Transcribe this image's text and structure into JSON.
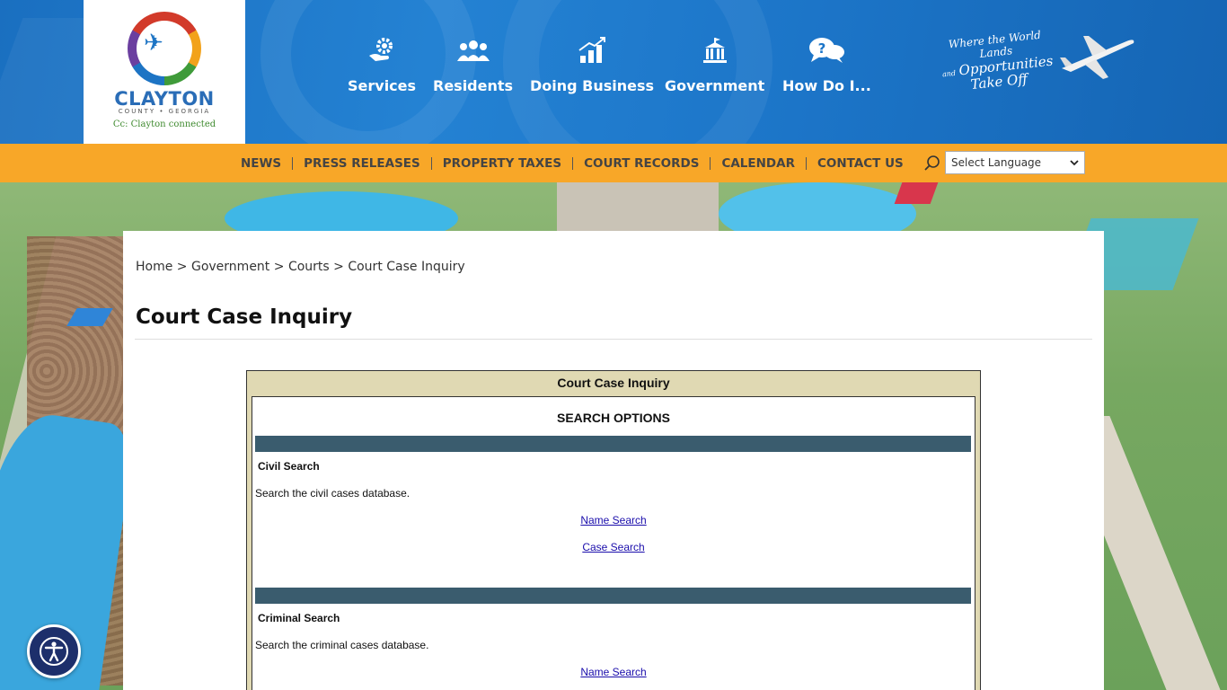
{
  "logo": {
    "name": "CLAYTON",
    "subtitle": "COUNTY • GEORGIA",
    "tagline": "Cc: Clayton connected"
  },
  "main_nav": [
    {
      "label": "Services",
      "icon": "gear-hand-icon"
    },
    {
      "label": "Residents",
      "icon": "people-icon"
    },
    {
      "label": "Doing Business",
      "icon": "bar-chart-icon"
    },
    {
      "label": "Government",
      "icon": "capitol-building-icon"
    },
    {
      "label": "How Do I...",
      "icon": "question-bubble-icon"
    }
  ],
  "header_tagline": {
    "line1": "Where the World Lands",
    "line2": "and",
    "line3": "Opportunities",
    "line4": "Take Off"
  },
  "top_nav": [
    "NEWS",
    "PRESS RELEASES",
    "PROPERTY TAXES",
    "COURT RECORDS",
    "CALENDAR",
    "CONTACT US"
  ],
  "language": {
    "selected": "Select Language"
  },
  "breadcrumb": {
    "home": "Home",
    "sep": ">",
    "level1": "Government",
    "level2": "Courts",
    "current": "Court Case Inquiry"
  },
  "page_title": "Court Case Inquiry",
  "inquiry": {
    "header": "Court Case Inquiry",
    "options_title": "SEARCH OPTIONS",
    "civil": {
      "title": "Civil Search",
      "description": "Search the civil cases database.",
      "links": [
        "Name Search",
        "Case Search"
      ]
    },
    "criminal": {
      "title": "Criminal Search",
      "description": "Search the criminal cases database.",
      "links": [
        "Name Search"
      ]
    }
  },
  "colors": {
    "header_blue": "#1c75c8",
    "topbar_orange": "#f8a728",
    "inquiry_tan": "#e0d9b3",
    "section_bar": "#3a5c6e",
    "link": "#1a0dab",
    "a11y": "#1d2f6b"
  }
}
